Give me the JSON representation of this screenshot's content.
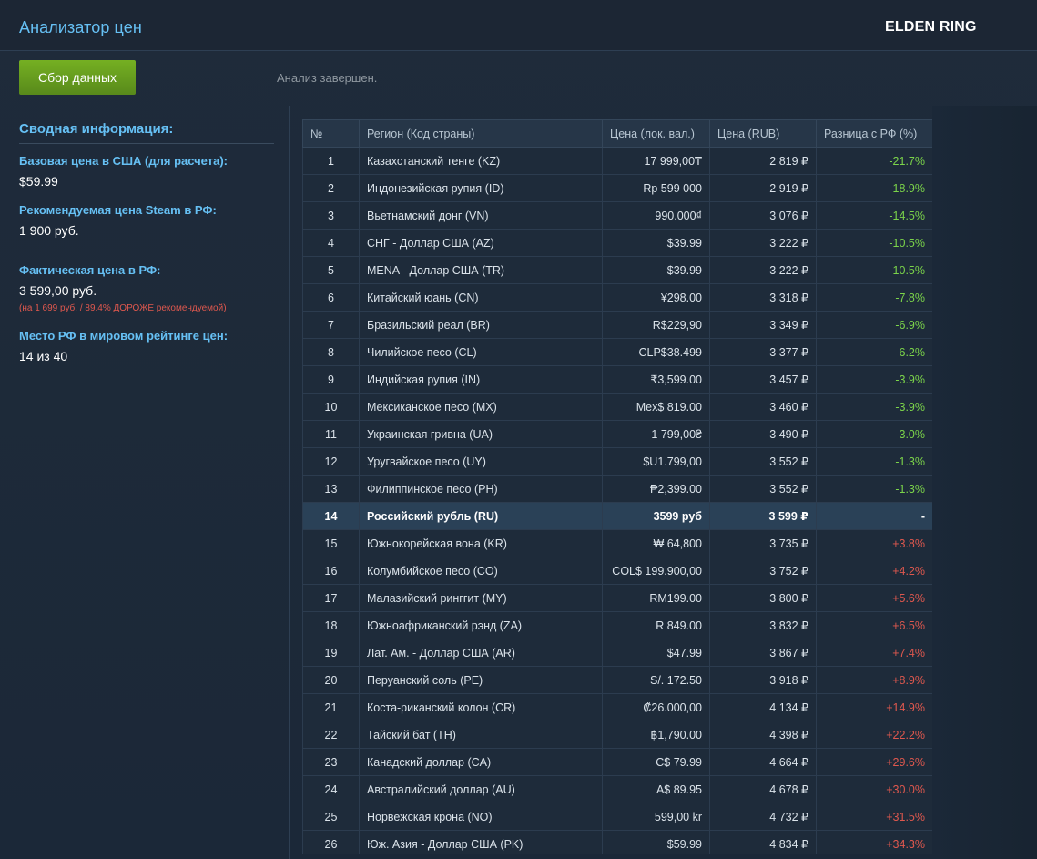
{
  "header": {
    "app_title": "Анализатор цен",
    "game_title": "ELDEN RING"
  },
  "toolbar": {
    "collect_label": "Сбор данных",
    "status": "Анализ завершен."
  },
  "summary": {
    "title": "Сводная информация:",
    "base_price_label": "Базовая цена в США (для расчета):",
    "base_price_value": "$59.99",
    "recommended_label": "Рекомендуемая цена Steam в РФ:",
    "recommended_value": "1 900 руб.",
    "actual_label": "Фактическая цена в РФ:",
    "actual_value": "3 599,00 руб.",
    "actual_note": "(на 1 699 руб. / 89.4% ДОРОЖЕ рекомендуемой)",
    "rank_label": "Место РФ в мировом рейтинге цен:",
    "rank_value": "14 из 40"
  },
  "table": {
    "columns": [
      "№",
      "Регион (Код страны)",
      "Цена (лок. вал.)",
      "Цена (RUB)",
      "Разница с РФ (%)"
    ],
    "rows": [
      {
        "num": "1",
        "region": "Казахстанский тенге (KZ)",
        "local": "17 999,00₸",
        "rub": "2 819 ₽",
        "diff": "-21.7%",
        "sign": "neg"
      },
      {
        "num": "2",
        "region": "Индонезийская рупия (ID)",
        "local": "Rp 599 000",
        "rub": "2 919 ₽",
        "diff": "-18.9%",
        "sign": "neg"
      },
      {
        "num": "3",
        "region": "Вьетнамский донг (VN)",
        "local": "990.000₫",
        "rub": "3 076 ₽",
        "diff": "-14.5%",
        "sign": "neg"
      },
      {
        "num": "4",
        "region": "СНГ - Доллар США (AZ)",
        "local": "$39.99",
        "rub": "3 222 ₽",
        "diff": "-10.5%",
        "sign": "neg"
      },
      {
        "num": "5",
        "region": "MENA - Доллар США (TR)",
        "local": "$39.99",
        "rub": "3 222 ₽",
        "diff": "-10.5%",
        "sign": "neg"
      },
      {
        "num": "6",
        "region": "Китайский юань (CN)",
        "local": "¥298.00",
        "rub": "3 318 ₽",
        "diff": "-7.8%",
        "sign": "neg"
      },
      {
        "num": "7",
        "region": "Бразильский реал (BR)",
        "local": "R$229,90",
        "rub": "3 349 ₽",
        "diff": "-6.9%",
        "sign": "neg"
      },
      {
        "num": "8",
        "region": "Чилийское песо (CL)",
        "local": "CLP$38.499",
        "rub": "3 377 ₽",
        "diff": "-6.2%",
        "sign": "neg"
      },
      {
        "num": "9",
        "region": "Индийская рупия (IN)",
        "local": "₹3,599.00",
        "rub": "3 457 ₽",
        "diff": "-3.9%",
        "sign": "neg"
      },
      {
        "num": "10",
        "region": "Мексиканское песо (MX)",
        "local": "Mex$ 819.00",
        "rub": "3 460 ₽",
        "diff": "-3.9%",
        "sign": "neg"
      },
      {
        "num": "11",
        "region": "Украинская гривна (UA)",
        "local": "1 799,00₴",
        "rub": "3 490 ₽",
        "diff": "-3.0%",
        "sign": "neg"
      },
      {
        "num": "12",
        "region": "Уругвайское песо (UY)",
        "local": "$U1.799,00",
        "rub": "3 552 ₽",
        "diff": "-1.3%",
        "sign": "neg"
      },
      {
        "num": "13",
        "region": "Филиппинское песо (PH)",
        "local": "₱2,399.00",
        "rub": "3 552 ₽",
        "diff": "-1.3%",
        "sign": "neg"
      },
      {
        "num": "14",
        "region": "Российский рубль (RU)",
        "local": "3599 руб",
        "rub": "3 599 ₽",
        "diff": "-",
        "sign": "self"
      },
      {
        "num": "15",
        "region": "Южнокорейская вона (KR)",
        "local": "₩ 64,800",
        "rub": "3 735 ₽",
        "diff": "+3.8%",
        "sign": "pos"
      },
      {
        "num": "16",
        "region": "Колумбийское песо (CO)",
        "local": "COL$ 199.900,00",
        "rub": "3 752 ₽",
        "diff": "+4.2%",
        "sign": "pos"
      },
      {
        "num": "17",
        "region": "Малазийский ринггит (MY)",
        "local": "RM199.00",
        "rub": "3 800 ₽",
        "diff": "+5.6%",
        "sign": "pos"
      },
      {
        "num": "18",
        "region": "Южноафриканский рэнд (ZA)",
        "local": "R 849.00",
        "rub": "3 832 ₽",
        "diff": "+6.5%",
        "sign": "pos"
      },
      {
        "num": "19",
        "region": "Лат. Ам. - Доллар США (AR)",
        "local": "$47.99",
        "rub": "3 867 ₽",
        "diff": "+7.4%",
        "sign": "pos"
      },
      {
        "num": "20",
        "region": "Перуанский соль (PE)",
        "local": "S/. 172.50",
        "rub": "3 918 ₽",
        "diff": "+8.9%",
        "sign": "pos"
      },
      {
        "num": "21",
        "region": "Коста-риканский колон (CR)",
        "local": "₡26.000,00",
        "rub": "4 134 ₽",
        "diff": "+14.9%",
        "sign": "pos"
      },
      {
        "num": "22",
        "region": "Тайский бат (TH)",
        "local": "฿1,790.00",
        "rub": "4 398 ₽",
        "diff": "+22.2%",
        "sign": "pos"
      },
      {
        "num": "23",
        "region": "Канадский доллар (CA)",
        "local": "C$ 79.99",
        "rub": "4 664 ₽",
        "diff": "+29.6%",
        "sign": "pos"
      },
      {
        "num": "24",
        "region": "Австралийский доллар (AU)",
        "local": "A$ 89.95",
        "rub": "4 678 ₽",
        "diff": "+30.0%",
        "sign": "pos"
      },
      {
        "num": "25",
        "region": "Норвежская крона (NO)",
        "local": "599,00 kr",
        "rub": "4 732 ₽",
        "diff": "+31.5%",
        "sign": "pos"
      },
      {
        "num": "26",
        "region": "Юж. Азия - Доллар США (PK)",
        "local": "$59.99",
        "rub": "4 834 ₽",
        "diff": "+34.3%",
        "sign": "pos"
      }
    ]
  },
  "colors": {
    "accent": "#66c0f4",
    "button": "#75b022",
    "negative_diff": "#7bd44a",
    "positive_diff": "#e0584e",
    "background": "#1b2838"
  }
}
